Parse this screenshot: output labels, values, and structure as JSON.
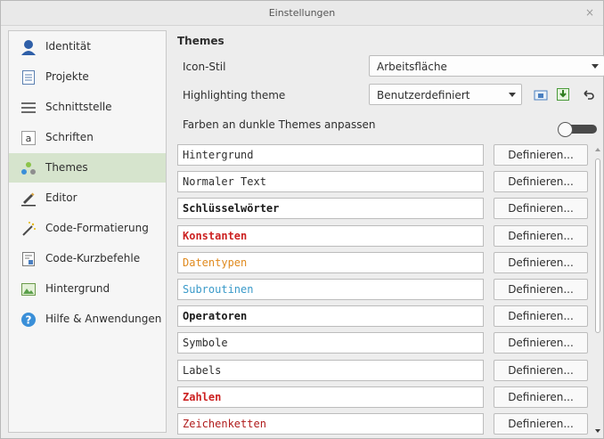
{
  "window": {
    "title": "Einstellungen",
    "close_glyph": "×"
  },
  "sidebar": {
    "items": [
      {
        "label": "Identität",
        "icon": "person-icon"
      },
      {
        "label": "Projekte",
        "icon": "document-icon"
      },
      {
        "label": "Schnittstelle",
        "icon": "menu-lines-icon"
      },
      {
        "label": "Schriften",
        "icon": "font-letter-icon"
      },
      {
        "label": "Themes",
        "icon": "palette-dots-icon",
        "active": true
      },
      {
        "label": "Editor",
        "icon": "pencil-icon"
      },
      {
        "label": "Code-Formatierung",
        "icon": "magic-wand-icon"
      },
      {
        "label": "Code-Kurzbefehle",
        "icon": "snippet-icon"
      },
      {
        "label": "Hintergrund",
        "icon": "image-icon"
      },
      {
        "label": "Hilfe & Anwendungen",
        "icon": "help-icon"
      }
    ]
  },
  "themes": {
    "section_title": "Themes",
    "icon_style_label": "Icon-Stil",
    "icon_style_value": "Arbeitsfläche",
    "highlighting_label": "Highlighting theme",
    "highlighting_value": "Benutzerdefiniert",
    "dark_adapt_label": "Farben an dunkle Themes anpassen",
    "dark_adapt_on": false,
    "colors": [
      {
        "name": "Hintergrund",
        "color": "#2e2e2e",
        "bold": false
      },
      {
        "name": "Normaler Text",
        "color": "#2e2e2e",
        "bold": false
      },
      {
        "name": "Schlüsselwörter",
        "color": "#1a1a1a",
        "bold": true
      },
      {
        "name": "Konstanten",
        "color": "#cc2222",
        "bold": true
      },
      {
        "name": "Datentypen",
        "color": "#e08a1e",
        "bold": false
      },
      {
        "name": "Subroutinen",
        "color": "#3a9ac9",
        "bold": false
      },
      {
        "name": "Operatoren",
        "color": "#1a1a1a",
        "bold": true
      },
      {
        "name": "Symbole",
        "color": "#2e2e2e",
        "bold": false
      },
      {
        "name": "Labels",
        "color": "#2e2e2e",
        "bold": false
      },
      {
        "name": "Zahlen",
        "color": "#cc2222",
        "bold": true
      },
      {
        "name": "Zeichenketten",
        "color": "#b01c1c",
        "bold": false
      }
    ],
    "define_label": "Definieren..."
  }
}
